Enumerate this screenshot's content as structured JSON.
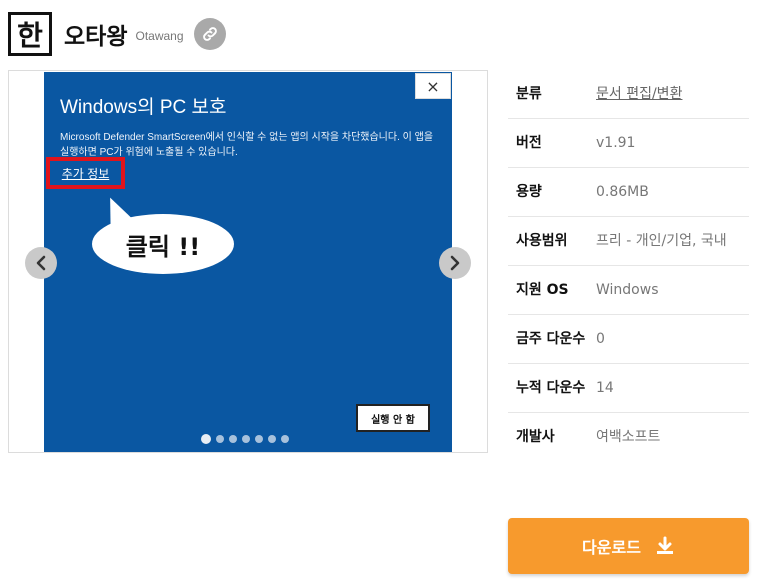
{
  "header": {
    "icon_char": "한",
    "title": "오타왕",
    "subtitle": "Otawang"
  },
  "gallery": {
    "slide": {
      "close_label": "×",
      "heading": "Windows의 PC 보호",
      "body": "Microsoft Defender SmartScreen에서 인식할 수 없는 앱의 시작을 차단했습니다. 이 앱을 실행하면 PC가 위험에 노출될 수 있습니다.",
      "more_info": "추가 정보",
      "bubble_text": "클릭 !!",
      "run_button": "실행 안 함"
    },
    "dots_total": 7,
    "active_dot": 0
  },
  "info": {
    "rows": [
      {
        "label": "분류",
        "value": "문서 편집/변환",
        "is_link": true
      },
      {
        "label": "버전",
        "value": "v1.91",
        "is_link": false
      },
      {
        "label": "용량",
        "value": "0.86MB",
        "is_link": false
      },
      {
        "label": "사용범위",
        "value": "프리 - 개인/기업, 국내",
        "is_link": false
      },
      {
        "label": "지원 OS",
        "value": "Windows",
        "is_link": false
      },
      {
        "label": "금주 다운수",
        "value": "0",
        "is_link": false
      },
      {
        "label": "누적 다운수",
        "value": "14",
        "is_link": false
      },
      {
        "label": "개발사",
        "value": "여백소프트",
        "is_link": false
      }
    ]
  },
  "download": {
    "label": "다운로드"
  },
  "colors": {
    "accent": "#f79a2d",
    "slide_bg": "#0a57a2",
    "highlight": "#e0141c"
  }
}
